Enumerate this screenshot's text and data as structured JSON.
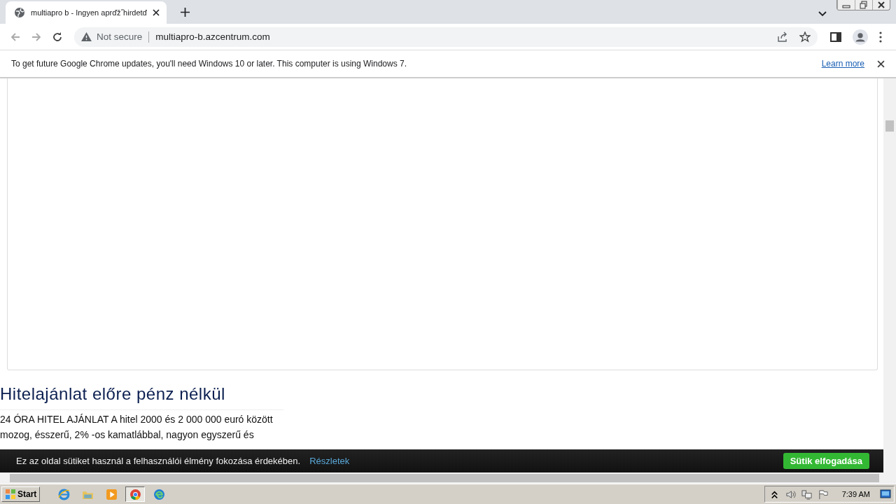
{
  "tab": {
    "title": "multiapro b - Ingyen aprďž˝hirdetď"
  },
  "address_bar": {
    "security": "Not secure",
    "url": "multiapro-b.azcentrum.com"
  },
  "infobar": {
    "message": "To get future Google Chrome updates, you'll need Windows 10 or later. This computer is using Windows 7.",
    "link": "Learn more"
  },
  "article": {
    "heading": "Hitelajánlat előre pénz nélkül",
    "lines": [
      "24 ÓRA HITEL AJÁNLAT A hitel 2000 és 2 000 000 euró között",
      "mozog, ésszerű, 2% -os kamatlábbal, nagyon egyszerű és"
    ]
  },
  "cookie_banner": {
    "message": "Ez az oldal sütiket használ a felhasználói élmény fokozása érdekében.",
    "link": "Részletek",
    "button": "Sütik elfogadása"
  },
  "taskbar": {
    "start": "Start",
    "apps": [
      {
        "kind": "ie",
        "selected": false
      },
      {
        "kind": "folder",
        "selected": false
      },
      {
        "kind": "media",
        "selected": false
      },
      {
        "kind": "chrome",
        "selected": true
      },
      {
        "kind": "edge",
        "selected": false
      }
    ],
    "clock": "7:39 AM"
  }
}
